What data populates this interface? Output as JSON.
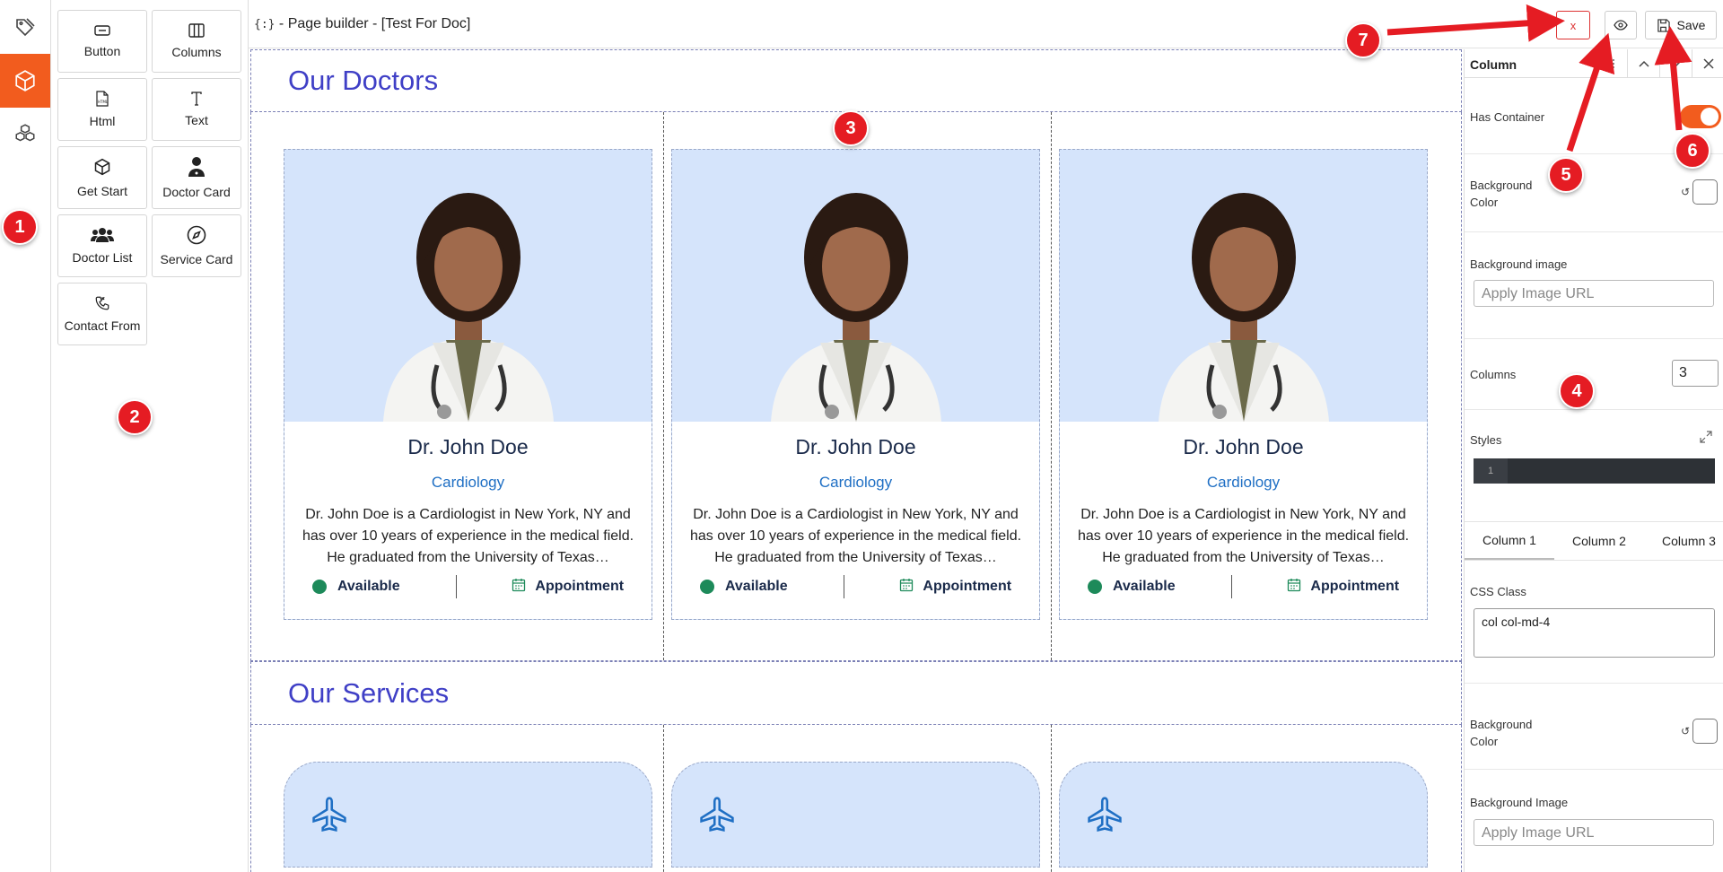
{
  "rail": {
    "items": [
      {
        "icon": "tags-icon"
      },
      {
        "icon": "cube-icon",
        "active": true
      },
      {
        "icon": "cubes-icon"
      }
    ]
  },
  "palette": {
    "items": [
      {
        "label": "Button",
        "icon": "button-icon"
      },
      {
        "label": "Columns",
        "icon": "columns-icon"
      },
      {
        "label": "Html",
        "icon": "html-icon"
      },
      {
        "label": "Text",
        "icon": "text-icon"
      },
      {
        "label": "Get Start",
        "icon": "box-icon"
      },
      {
        "label": "Doctor Card",
        "icon": "doctor-icon"
      },
      {
        "label": "Doctor List",
        "icon": "users-icon"
      },
      {
        "label": "Service Card",
        "icon": "compass-icon"
      },
      {
        "label": "Contact From",
        "icon": "phone-icon"
      }
    ]
  },
  "topbar": {
    "brand": "{:}",
    "title": " - Page builder - [Test For Doc]",
    "close_label": "x",
    "save_label": "Save"
  },
  "canvas": {
    "doctors_heading": "Our Doctors",
    "services_heading": "Our Services",
    "doctor_cards": [
      {
        "name": "Dr. John Doe",
        "specialty": "Cardiology",
        "desc": "Dr. John Doe is a Cardiologist in New York, NY and has over 10 years of experience in the medical field. He graduated from the University of Texas…",
        "status": "Available",
        "action": "Appointment"
      },
      {
        "name": "Dr. John Doe",
        "specialty": "Cardiology",
        "desc": "Dr. John Doe is a Cardiologist in New York, NY and has over 10 years of experience in the medical field. He graduated from the University of Texas…",
        "status": "Available",
        "action": "Appointment"
      },
      {
        "name": "Dr. John Doe",
        "specialty": "Cardiology",
        "desc": "Dr. John Doe is a Cardiologist in New York, NY and has over 10 years of experience in the medical field. He graduated from the University of Texas…",
        "status": "Available",
        "action": "Appointment"
      }
    ],
    "service_icon": "plane-icon"
  },
  "panel": {
    "title": "Column",
    "has_container_label": "Has Container",
    "has_container": true,
    "bg_color_label": "Background Color",
    "bg_image_label": "Background image",
    "bg_image_placeholder": "Apply Image URL",
    "columns_label": "Columns",
    "columns_value": "3",
    "styles_label": "Styles",
    "styles_line": "1",
    "tabs": [
      "Column 1",
      "Column 2",
      "Column 3"
    ],
    "css_class_label": "CSS Class",
    "css_class_value": "col col-md-4",
    "col_bg_color_label": "Background Color",
    "col_bg_image_label": "Background Image",
    "col_bg_image_placeholder": "Apply Image URL"
  },
  "annotations": [
    "1",
    "2",
    "3",
    "4",
    "5",
    "6",
    "7"
  ],
  "colors": {
    "accent": "#f25c1e",
    "heading": "#3f3fc6",
    "card_bg": "#d5e4fb",
    "badge": "#e51c23",
    "available": "#1d8a5a"
  }
}
